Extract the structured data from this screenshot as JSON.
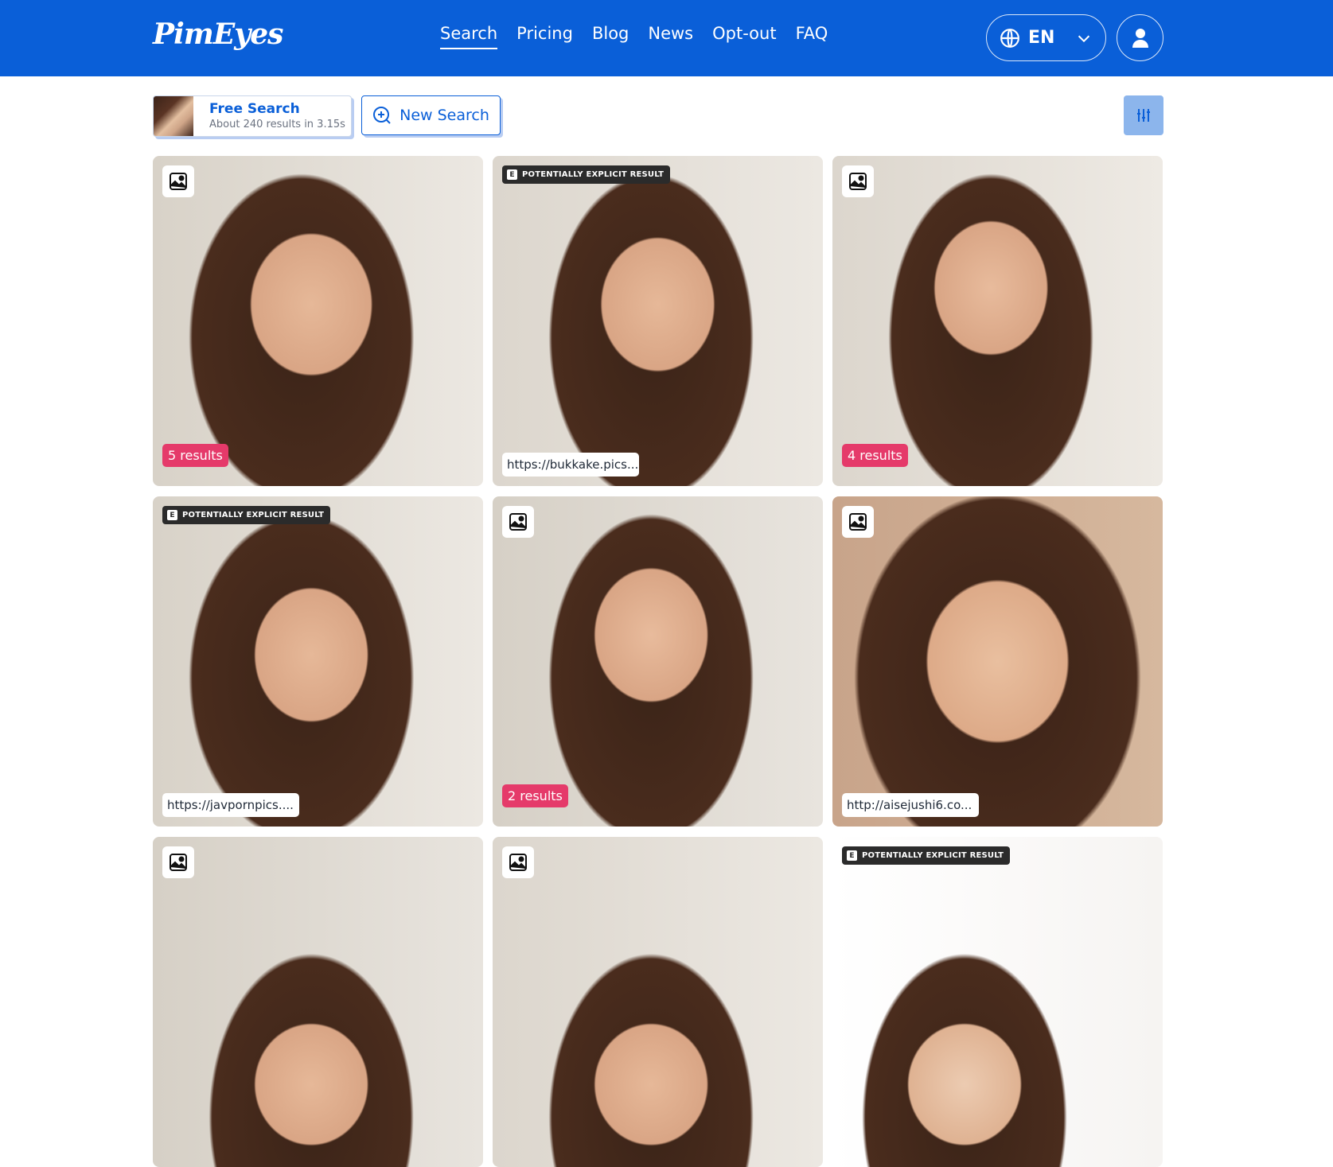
{
  "header": {
    "logo": "PimEyes",
    "nav": [
      "Search",
      "Pricing",
      "Blog",
      "News",
      "Opt-out",
      "FAQ"
    ],
    "active_nav": "Search",
    "language": "EN"
  },
  "toolbar": {
    "free_search_title": "Free Search",
    "free_search_sub": "About 240 results in 3.15s",
    "new_search_label": "New Search"
  },
  "results": [
    {
      "badge": "5 results",
      "explicit": "",
      "url": ""
    },
    {
      "badge": "",
      "explicit": "POTENTIALLY EXPLICIT RESULT",
      "url": "https://bukkake.pics..."
    },
    {
      "badge": "4 results",
      "explicit": "",
      "url": ""
    },
    {
      "badge": "",
      "explicit": "POTENTIALLY EXPLICIT RESULT",
      "url": "https://javpornpics...."
    },
    {
      "badge": "2 results",
      "explicit": "",
      "url": ""
    },
    {
      "badge": "",
      "explicit": "",
      "url": "http://aisejushi6.co..."
    },
    {
      "badge": "",
      "explicit": "",
      "url": ""
    },
    {
      "badge": "",
      "explicit": "",
      "url": ""
    },
    {
      "badge": "",
      "explicit": "POTENTIALLY EXPLICIT RESULT",
      "url": ""
    }
  ],
  "colors": {
    "brand": "#0a5fd8",
    "results_badge": "#e53a6a",
    "explicit_badge": "#2b2b2b"
  }
}
